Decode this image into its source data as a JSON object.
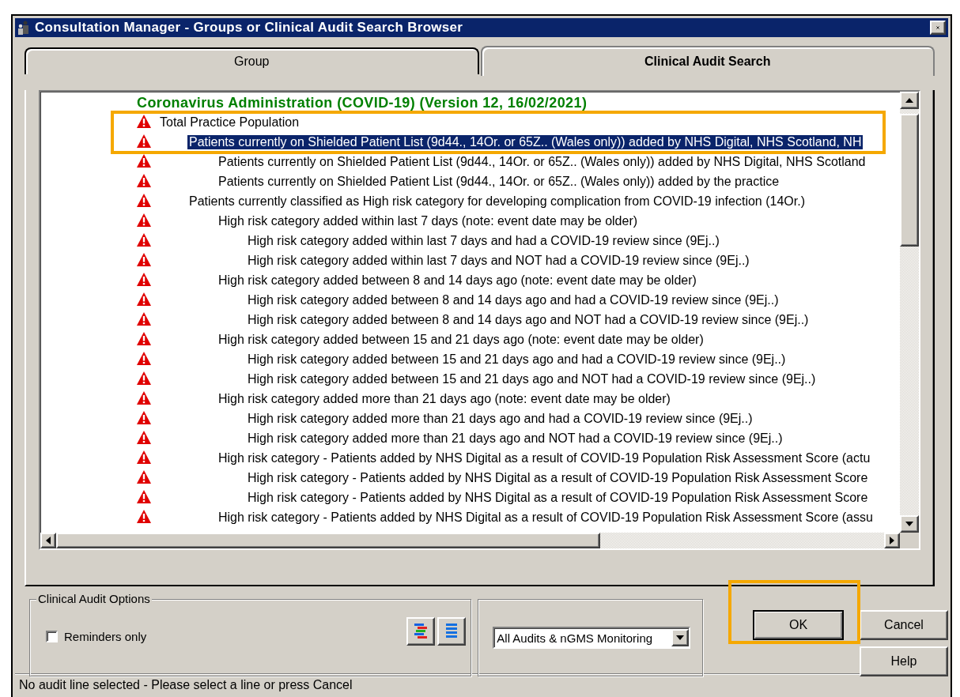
{
  "window": {
    "title": "Consultation Manager - Groups or Clinical Audit Search Browser"
  },
  "tabs": [
    {
      "label": "Group",
      "selected": false
    },
    {
      "label": "Clinical Audit Search",
      "selected": true
    }
  ],
  "tree": {
    "heading": "Coronavirus Administration (COVID-19) (Version 12, 16/02/2021)",
    "items": [
      {
        "label": "Total Practice Population",
        "selected": false,
        "children": [
          {
            "label": "Patients currently on Shielded Patient List (9d44., 14Or. or 65Z.. (Wales only)) added by NHS Digital, NHS Scotland, NH",
            "selected": true,
            "children": [
              {
                "label": "Patients currently on Shielded Patient List (9d44., 14Or. or 65Z.. (Wales only)) added by NHS Digital, NHS Scotland",
                "selected": false
              },
              {
                "label": "Patients currently on Shielded Patient List (9d44., 14Or. or 65Z.. (Wales only)) added by the practice",
                "selected": false
              }
            ]
          },
          {
            "label": "Patients currently classified as High risk category for developing complication from COVID-19 infection (14Or.)",
            "selected": false,
            "children": [
              {
                "label": "High risk category added within last 7 days (note: event date may be older)",
                "selected": false,
                "children": [
                  {
                    "label": "High risk category added within last 7 days and had a COVID-19 review since (9Ej..)",
                    "selected": false
                  },
                  {
                    "label": "High risk category added within last 7 days and NOT had a COVID-19 review since (9Ej..)",
                    "selected": false
                  }
                ]
              },
              {
                "label": "High risk category added between 8 and 14 days ago (note: event date may be older)",
                "selected": false,
                "children": [
                  {
                    "label": "High risk category added between 8 and 14 days ago and had a COVID-19 review since (9Ej..)",
                    "selected": false
                  },
                  {
                    "label": "High risk category added between 8 and 14 days ago and NOT had a COVID-19 review since (9Ej..)",
                    "selected": false
                  }
                ]
              },
              {
                "label": "High risk category added between 15 and 21 days ago (note: event date may be older)",
                "selected": false,
                "children": [
                  {
                    "label": "High risk category added between 15 and 21 days ago and had a COVID-19 review since (9Ej..)",
                    "selected": false
                  },
                  {
                    "label": "High risk category added between 15 and 21 days ago and NOT had a COVID-19 review since (9Ej..)",
                    "selected": false
                  }
                ]
              },
              {
                "label": "High risk category added more than 21 days ago (note: event date may be older)",
                "selected": false,
                "children": [
                  {
                    "label": "High risk category added more than 21 days ago and had a COVID-19 review since (9Ej..)",
                    "selected": false
                  },
                  {
                    "label": "High risk category added more than 21 days ago and NOT had a COVID-19 review since (9Ej..)",
                    "selected": false
                  }
                ]
              },
              {
                "label": "High risk category - Patients added by NHS Digital as a result of COVID-19 Population Risk Assessment Score (actu",
                "selected": false,
                "children": [
                  {
                    "label": "High risk category - Patients added by NHS Digital as a result of COVID-19 Population Risk Assessment Score",
                    "selected": false
                  },
                  {
                    "label": "High risk category - Patients added by NHS Digital as a result of COVID-19 Population Risk Assessment Score",
                    "selected": false
                  }
                ]
              },
              {
                "label": "High risk category - Patients added by NHS Digital as a result of COVID-19 Population Risk Assessment Score (assu",
                "selected": false
              }
            ]
          }
        ]
      }
    ]
  },
  "options": {
    "title": "Clinical Audit Options",
    "reminders_only": {
      "label": "Reminders only",
      "checked": false
    }
  },
  "filter": {
    "value": "All Audits & nGMS Monitoring"
  },
  "buttons": [
    {
      "label": "OK",
      "default": true
    },
    {
      "label": "Cancel",
      "default": false
    },
    {
      "label": "Help",
      "default": false
    }
  ],
  "status_bar": "No audit line selected - Please select a line or press Cancel"
}
